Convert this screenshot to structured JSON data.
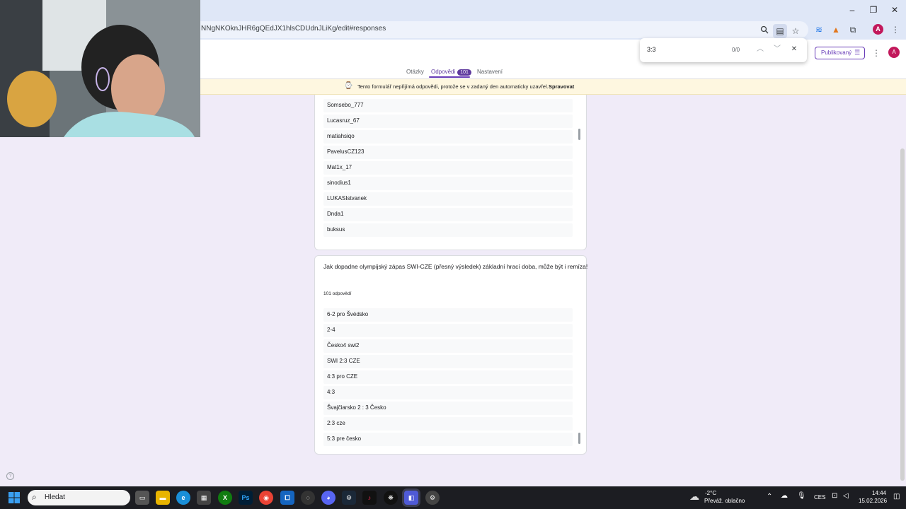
{
  "browser": {
    "url": "NNgNKOknJHR6gQEdJX1hlsCDUdnJLiKg/edit#responses",
    "window_controls": [
      "–",
      "❐",
      "✕"
    ]
  },
  "find_bar": {
    "query": "3:3",
    "count": "0/0"
  },
  "form_header": {
    "tabs": [
      {
        "label": "Otázky"
      },
      {
        "label": "Odpovědi",
        "badge": "101"
      },
      {
        "label": "Nastavení"
      }
    ],
    "publish_label": "Publikovaný",
    "avatar_letter": "A"
  },
  "banner": {
    "text": "Tento formulář nepřijímá odpovědi, protože se v zadaný den automaticky uzavřel.",
    "action": "Spravovat"
  },
  "question1": {
    "responses": [
      "Somsebo_777",
      "Lucasruz_67",
      "matiahsiqo",
      "PavelusCZ123",
      "Mat1x_17",
      "sinodius1",
      "LUKASIstvanek",
      "Dnda1",
      "buksus"
    ]
  },
  "question2": {
    "title": "Jak dopadne olympijský zápas SWI-CZE (přesný výsledek) základní hrací doba, může být i remíza!",
    "count": "101 odpovědí",
    "responses": [
      "6-2 pro Švédsko",
      "2-4",
      "Česko4 swi2",
      "SWI 2:3 CZE",
      "4:3 pro CZE",
      "4:3",
      "Švajčiarsko 2 : 3 Česko",
      "2:3 cze",
      "5:3 pre česko"
    ]
  },
  "taskbar": {
    "search_placeholder": "Hledat",
    "weather_temp": "-2°C",
    "weather_desc": "Převáž. oblačno",
    "language": "CES",
    "time": "14:44",
    "date": "15.02.2026"
  },
  "colors": {
    "accent": "#673ab7",
    "page_bg": "#f0ebf8",
    "banner_bg": "#fef7e0"
  }
}
